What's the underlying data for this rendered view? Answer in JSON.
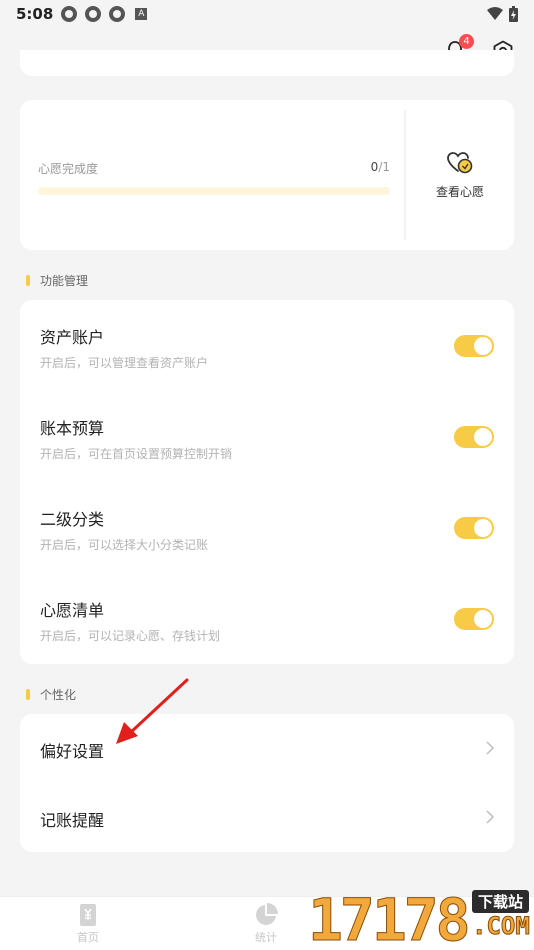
{
  "status_bar": {
    "time": "5:08",
    "a_label": "A"
  },
  "header": {
    "notification_count": "4"
  },
  "wish_card": {
    "progress_label": "心愿完成度",
    "completed": "0",
    "total": "/1",
    "progress_fraction": 0,
    "view_label": "查看心愿"
  },
  "features": {
    "title": "功能管理",
    "items": [
      {
        "title": "资产账户",
        "desc": "开启后，可以管理查看资产账户",
        "enabled": true
      },
      {
        "title": "账本预算",
        "desc": "开启后，可在首页设置预算控制开销",
        "enabled": true
      },
      {
        "title": "二级分类",
        "desc": "开启后，可以选择大小分类记账",
        "enabled": true
      },
      {
        "title": "心愿清单",
        "desc": "开启后，可以记录心愿、存钱计划",
        "enabled": true
      }
    ]
  },
  "personal": {
    "title": "个性化",
    "items": [
      {
        "label": "偏好设置"
      },
      {
        "label": "记账提醒"
      }
    ]
  },
  "tabs": [
    {
      "label": "首页"
    },
    {
      "label": "统计"
    }
  ],
  "watermark": {
    "digits": "17178",
    "tag": "下载站",
    "com": ".COM"
  },
  "colors": {
    "accent": "#f7cb45",
    "badge": "#f4504f",
    "arrow": "#e0201c"
  }
}
